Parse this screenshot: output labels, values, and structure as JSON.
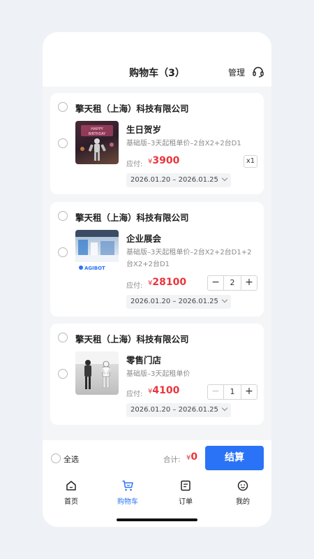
{
  "header": {
    "title": "购物车（3）",
    "manage_label": "管理"
  },
  "items": [
    {
      "shop": "擎天租（上海）科技有限公司",
      "name": "生日贺岁",
      "desc": "基础版–3天起租单价–2台X2+2台D1",
      "due_label": "应付:",
      "currency": "¥",
      "price": "3900",
      "date_range": "2026.01.20 – 2026.01.25",
      "qty_badge": "x1"
    },
    {
      "shop": "擎天租（上海）科技有限公司",
      "name": "企业展会",
      "desc": "基础版–3天起租单价–2台X2+2台D1+2台X2+2台D1",
      "due_label": "应付:",
      "currency": "¥",
      "price": "28100",
      "date_range": "2026.01.20 – 2026.01.25",
      "qty": "2",
      "minus": "−",
      "plus": "+",
      "thumb_logo": "AGIBOT"
    },
    {
      "shop": "擎天租（上海）科技有限公司",
      "name": "零售门店",
      "desc": "基础版–3天起租单价",
      "due_label": "应付:",
      "currency": "¥",
      "price": "4100",
      "date_range": "2026.01.20 – 2026.01.25",
      "qty": "1",
      "minus": "−",
      "plus": "+"
    }
  ],
  "checkout": {
    "select_all": "全选",
    "total_label": "合计:",
    "currency": "¥",
    "total": "0",
    "pay_label": "结算"
  },
  "tabs": [
    {
      "label": "首页",
      "icon": "home-icon"
    },
    {
      "label": "购物车",
      "icon": "cart-icon",
      "active": true
    },
    {
      "label": "订单",
      "icon": "order-icon"
    },
    {
      "label": "我的",
      "icon": "profile-icon"
    }
  ],
  "colors": {
    "accent": "#2b73f6",
    "price": "#e8363c"
  }
}
